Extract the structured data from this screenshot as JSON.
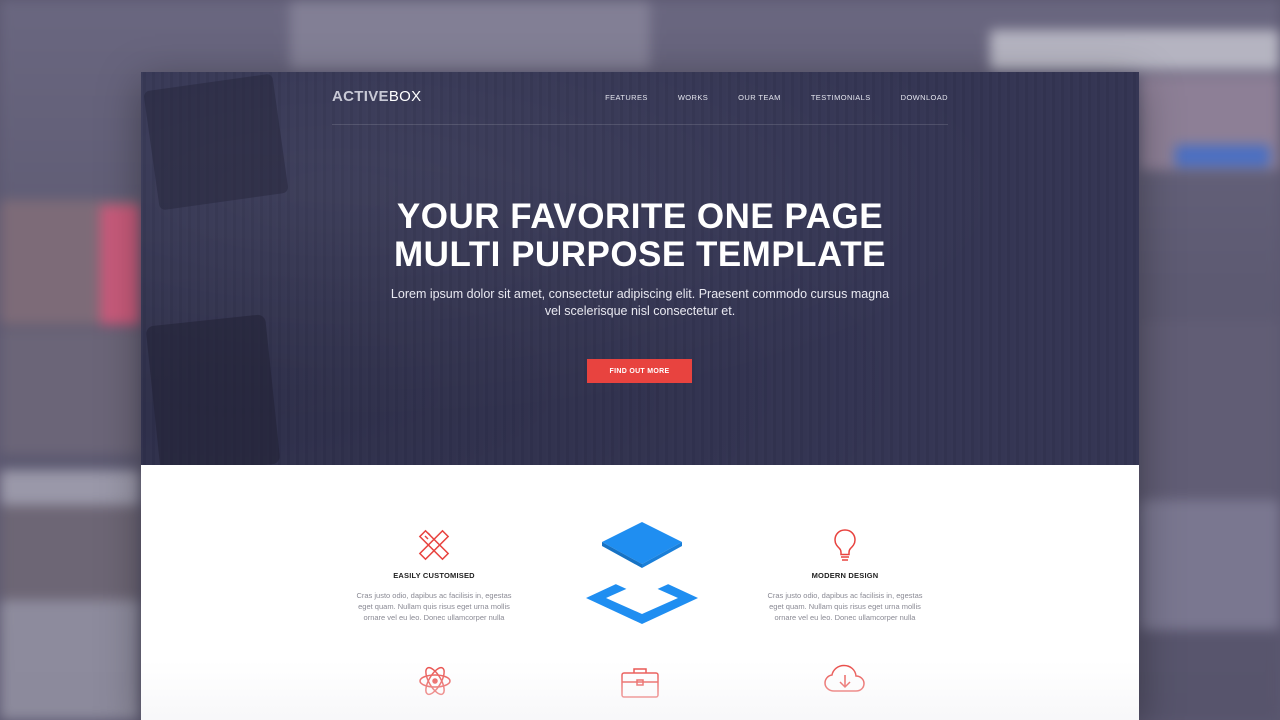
{
  "brand": {
    "part1": "ACTIVE",
    "part2": "BOX"
  },
  "nav": [
    {
      "label": "FEATURES"
    },
    {
      "label": "WORKS"
    },
    {
      "label": "OUR TEAM"
    },
    {
      "label": "TESTIMONIALS"
    },
    {
      "label": "DOWNLOAD"
    }
  ],
  "hero": {
    "title_line1": "YOUR FAVORITE ONE PAGE",
    "title_line2": "MULTI PURPOSE TEMPLATE",
    "subtitle": "Lorem ipsum dolor sit amet, consectetur adipiscing elit. Praesent commodo cursus magna vel scelerisque nisl consectetur et.",
    "cta_label": "FIND OUT MORE"
  },
  "features": [
    {
      "icon": "pencil-ruler-icon",
      "title": "EASILY CUSTOMISED",
      "text": "Cras justo odio, dapibus ac facilisis in, egestas eget quam. Nullam quis risus eget urna mollis ornare vel eu leo. Donec ullamcorper nulla"
    },
    {
      "icon": "lightbulb-icon",
      "title": "MODERN DESIGN",
      "text": "Cras justo odio, dapibus ac facilisis in, egestas eget quam. Nullam quis risus eget urna mollis ornare vel eu leo. Donec ullamcorper nulla"
    }
  ],
  "feature_icons_row2": [
    "atom-icon",
    "briefcase-icon",
    "cloud-download-icon"
  ],
  "center_logo": "layers-icon",
  "colors": {
    "hero_bg": "#333452",
    "accent": "#e8433f",
    "icon_blue": "#1f8ef1"
  }
}
